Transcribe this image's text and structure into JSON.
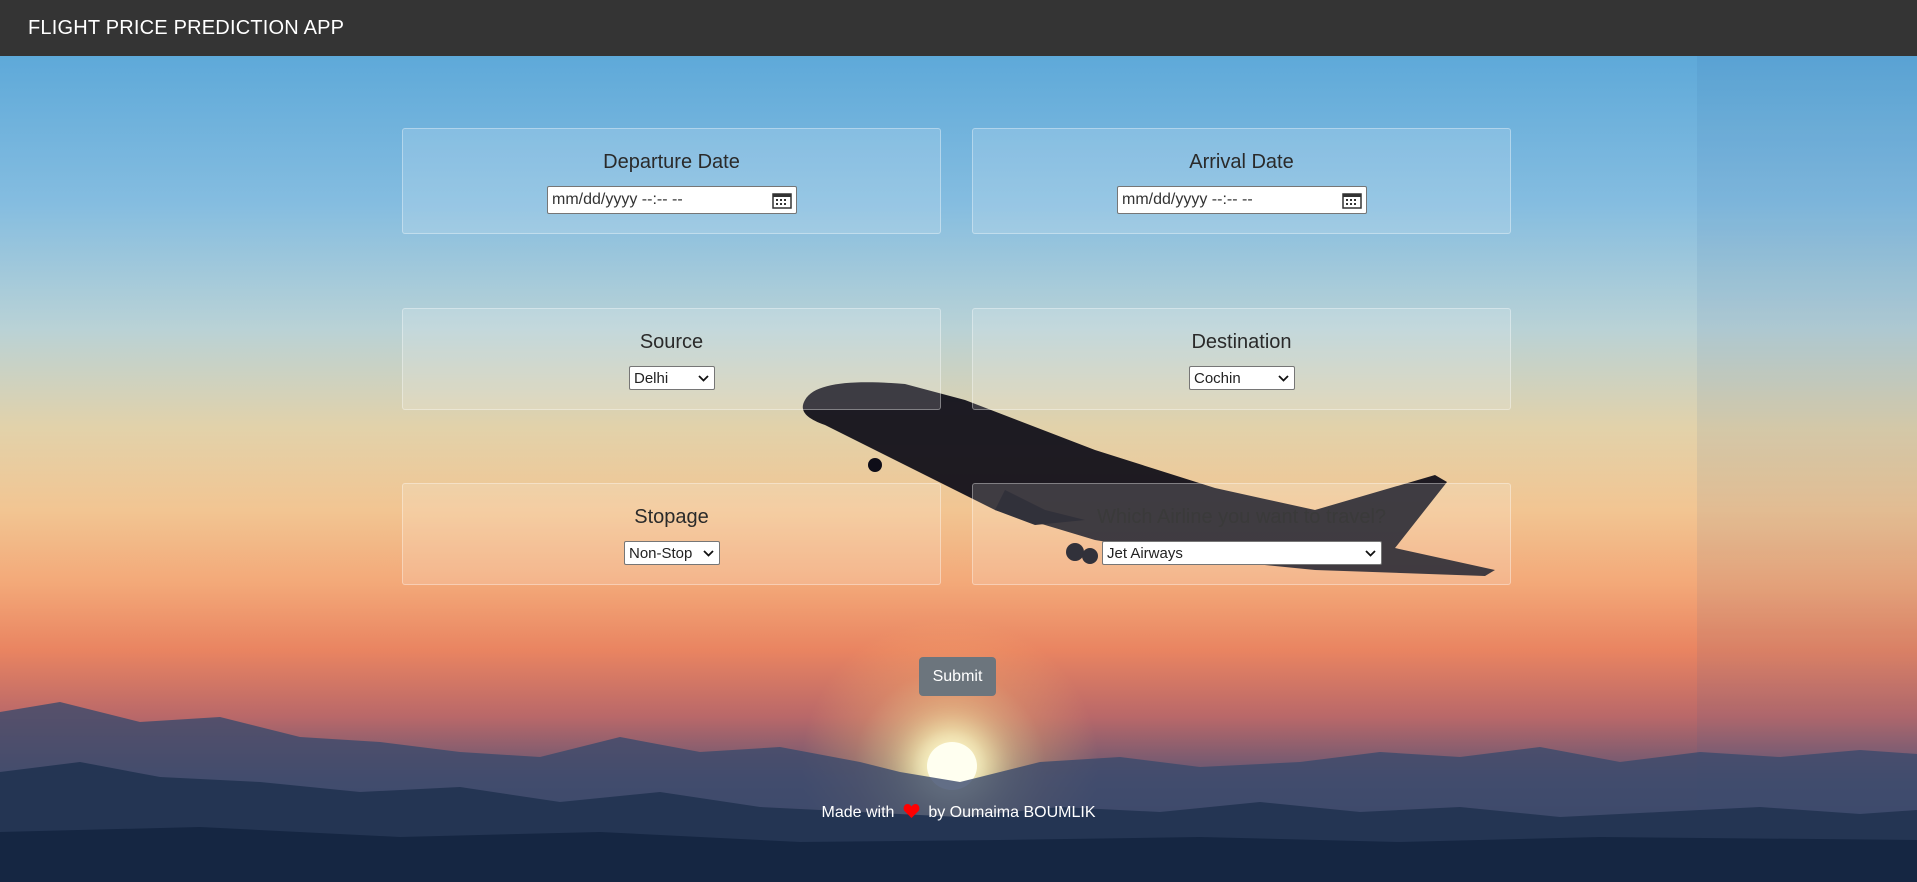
{
  "navbar": {
    "title": "FLIGHT PRICE PREDICTION APP"
  },
  "form": {
    "departure": {
      "label": "Departure Date",
      "placeholder": "mm/dd/yyyy  --:-- --"
    },
    "arrival": {
      "label": "Arrival Date",
      "placeholder": "mm/dd/yyyy  --:-- --"
    },
    "source": {
      "label": "Source",
      "selected": "Delhi"
    },
    "destination": {
      "label": "Destination",
      "selected": "Cochin"
    },
    "stopage": {
      "label": "Stopage",
      "selected": "Non-Stop"
    },
    "airline": {
      "label": "Which Airline you want to travel?",
      "selected": "Jet Airways"
    },
    "submit_label": "Submit"
  },
  "footer": {
    "made_with": "Made with",
    "by": "by Oumaima BOUMLIK"
  },
  "icons": {
    "calendar": "calendar-icon",
    "chevron": "chevron-down-icon",
    "heart": "heart-icon"
  },
  "colors": {
    "navbar": "#343434",
    "submit": "#6c757d",
    "heart": "#ff0000"
  }
}
